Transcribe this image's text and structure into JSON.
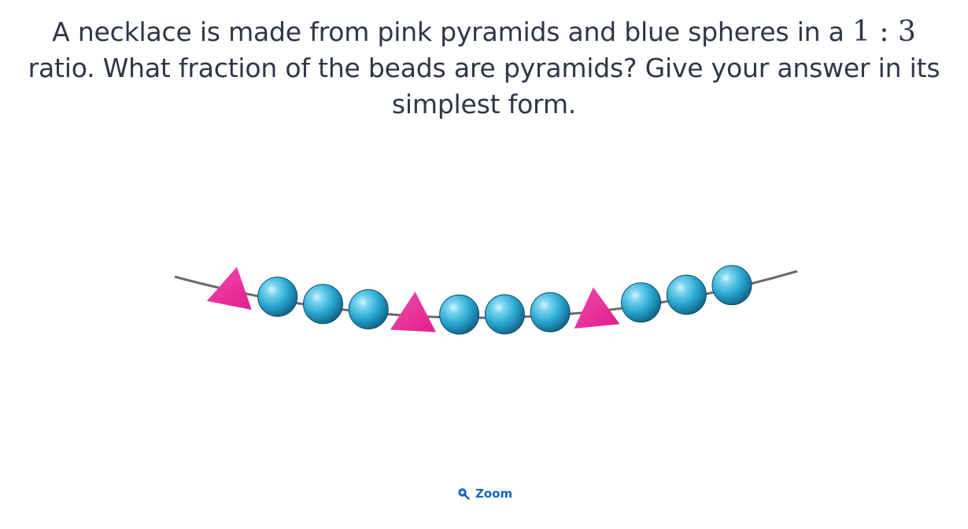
{
  "question": {
    "text_before": "A necklace is made from pink pyramids and blue spheres in a",
    "ratio": "1 : 3",
    "text_after": "ratio. What fraction of the beads are pyramids? Give your answer in its simplest form."
  },
  "necklace": {
    "beads": [
      "pyramid",
      "sphere",
      "sphere",
      "sphere",
      "pyramid",
      "sphere",
      "sphere",
      "sphere",
      "pyramid",
      "sphere",
      "sphere",
      "sphere"
    ],
    "pyramid_color": "#ec2f9b",
    "sphere_color": "#2aa9d2",
    "string_color": "#6b6b6b"
  },
  "zoom": {
    "label": "Zoom",
    "icon": "zoom-in-icon",
    "color": "#1565c0"
  }
}
